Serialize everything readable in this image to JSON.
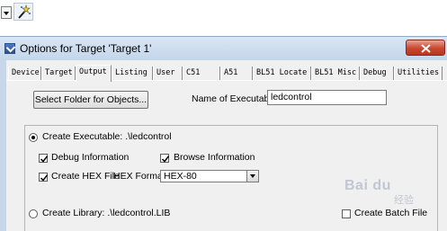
{
  "dialog": {
    "title": "Options for Target 'Target 1'",
    "tabs": [
      {
        "label": "Device",
        "active": false
      },
      {
        "label": "Target",
        "active": false
      },
      {
        "label": "Output",
        "active": true
      },
      {
        "label": "Listing",
        "active": false
      },
      {
        "label": "User",
        "active": false
      },
      {
        "label": "C51",
        "active": false
      },
      {
        "label": "A51",
        "active": false
      },
      {
        "label": "BL51 Locate",
        "active": false
      },
      {
        "label": "BL51 Misc",
        "active": false
      },
      {
        "label": "Debug",
        "active": false
      },
      {
        "label": "Utilities",
        "active": false
      }
    ]
  },
  "output": {
    "select_folder_label": "Select Folder for Objects...",
    "name_of_executable_label": "Name of Executable:",
    "name_of_executable_value": "ledcontrol",
    "create_executable": {
      "label": "Create Executable:  .\\ledcontrol",
      "selected": true
    },
    "debug_information": {
      "label": "Debug Information",
      "checked": true
    },
    "browse_information": {
      "label": "Browse Information",
      "checked": true
    },
    "create_hex_file": {
      "label": "Create HEX File",
      "checked": true
    },
    "hex_format_label": "HEX Format:",
    "hex_format_value": "HEX-80",
    "create_library": {
      "label": "Create Library:  .\\ledcontrol.LIB",
      "selected": false
    },
    "create_batch_file": {
      "label": "Create Batch File",
      "checked": false
    }
  },
  "watermark": {
    "text": "Bai du",
    "sub": "经验"
  },
  "colors": {
    "titlebar": "#c6d7ea",
    "close": "#c9472f",
    "client": "#f0f0f0"
  }
}
